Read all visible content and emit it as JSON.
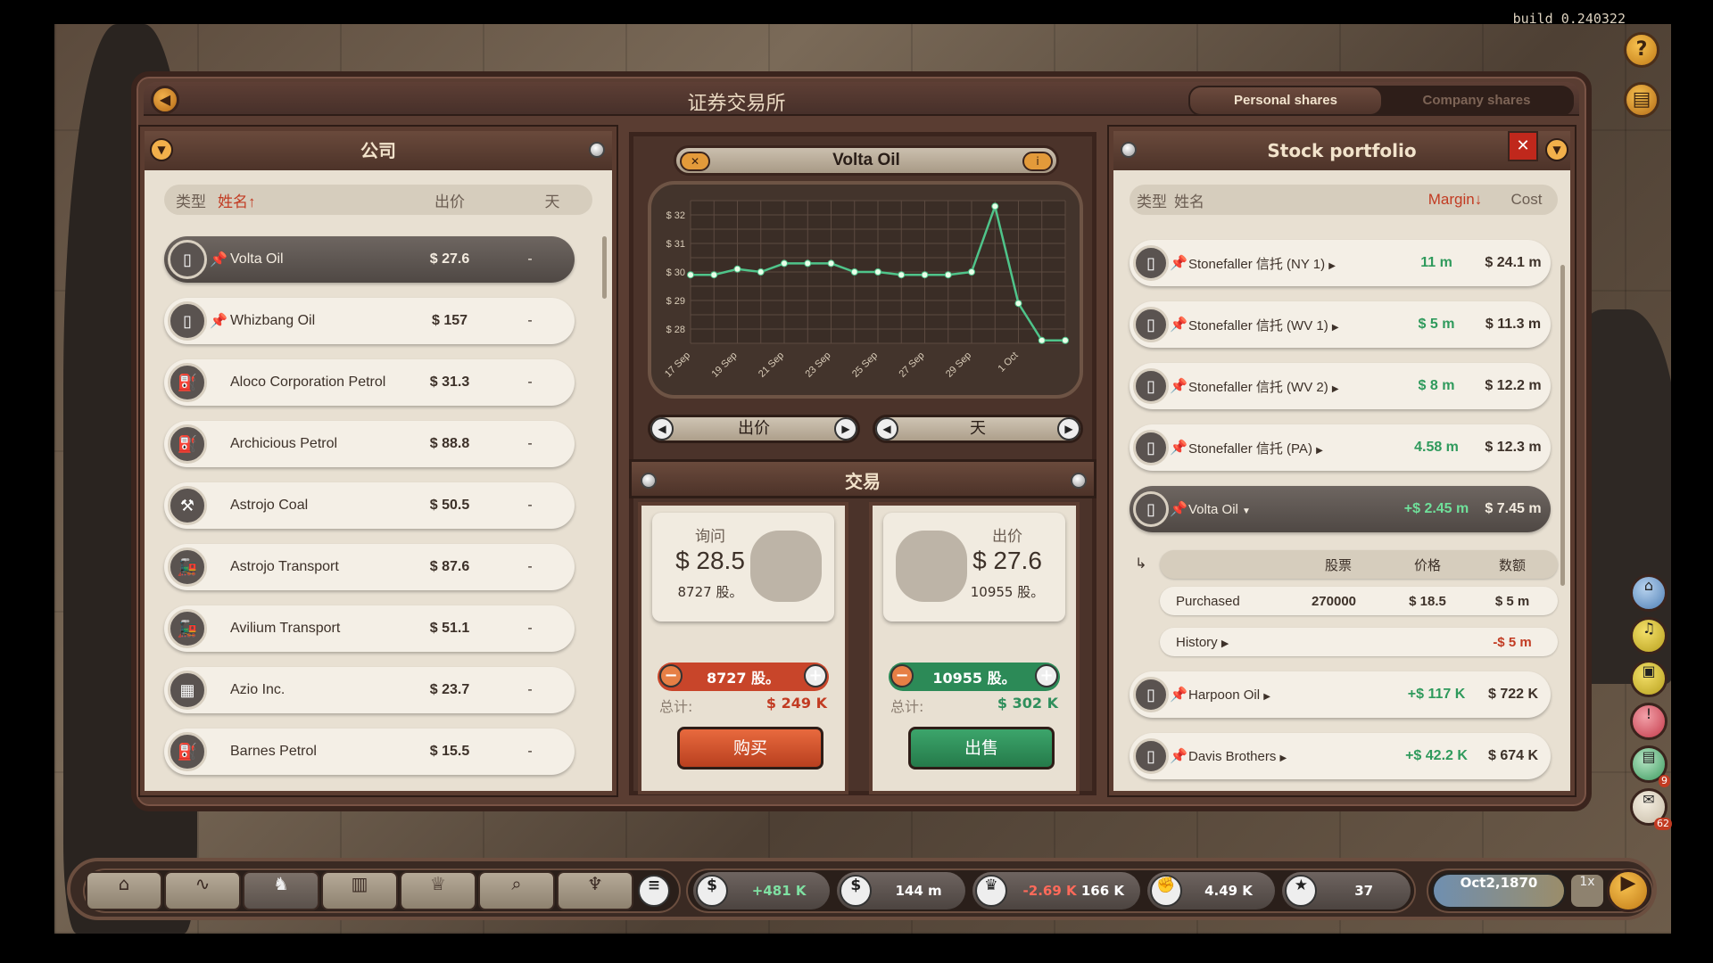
{
  "build": "build 0.240322",
  "window": {
    "title": "证券交易所",
    "tabs": [
      "Personal shares",
      "Company shares"
    ]
  },
  "companies": {
    "title": "公司",
    "headers": {
      "type": "类型",
      "name": "姓名↑",
      "price": "出价",
      "day": "天"
    },
    "rows": [
      {
        "name": "Volta Oil",
        "price": "$ 27.6",
        "day": "-",
        "icon": "oil-rig-icon",
        "pinned": true,
        "selected": true
      },
      {
        "name": "Whizbang Oil",
        "price": "$ 157",
        "day": "-",
        "icon": "oil-rig-icon",
        "pinned": true
      },
      {
        "name": "Aloco Corporation Petrol",
        "price": "$ 31.3",
        "day": "-",
        "icon": "oil-can-icon"
      },
      {
        "name": "Archicious Petrol",
        "price": "$ 88.8",
        "day": "-",
        "icon": "oil-can-icon"
      },
      {
        "name": "Astrojo Coal",
        "price": "$ 50.5",
        "day": "-",
        "icon": "miner-icon"
      },
      {
        "name": "Astrojo Transport",
        "price": "$ 87.6",
        "day": "-",
        "icon": "locomotive-icon"
      },
      {
        "name": "Avilium Transport",
        "price": "$ 51.1",
        "day": "-",
        "icon": "locomotive-icon"
      },
      {
        "name": "Azio Inc.",
        "price": "$ 23.7",
        "day": "-",
        "icon": "building-icon"
      },
      {
        "name": "Barnes Petrol",
        "price": "$ 15.5",
        "day": "-",
        "icon": "oil-can-icon"
      }
    ]
  },
  "chart_panel": {
    "company": "Volta Oil",
    "selector_left": "出价",
    "selector_right": "天"
  },
  "chart_data": {
    "type": "line",
    "title": "",
    "x": [
      "17 Sep",
      "18 Sep",
      "19 Sep",
      "20 Sep",
      "21 Sep",
      "22 Sep",
      "23 Sep",
      "24 Sep",
      "25 Sep",
      "26 Sep",
      "27 Sep",
      "28 Sep",
      "29 Sep",
      "30 Sep",
      "1 Oct",
      "2 Oct",
      "3 Oct"
    ],
    "x_ticks": [
      "17 Sep",
      "19 Sep",
      "21 Sep",
      "23 Sep",
      "25 Sep",
      "27 Sep",
      "29 Sep",
      "1 Oct"
    ],
    "values": [
      29.9,
      29.9,
      30.1,
      30.0,
      30.3,
      30.3,
      30.3,
      30.0,
      30.0,
      29.9,
      29.9,
      29.9,
      30.0,
      32.3,
      28.9,
      27.6,
      27.6
    ],
    "yticks": [
      "$ 32",
      "$ 31",
      "$ 30",
      "$ 29",
      "$ 28"
    ],
    "ylim": [
      27.5,
      32.5
    ],
    "color": "#4fc48a",
    "grid": true
  },
  "trade": {
    "title": "交易",
    "buy": {
      "label": "询问",
      "price": "$ 28.5",
      "shares": "8727 股。",
      "qty": "8727 股。",
      "total_label": "总计:",
      "total": "$ 249 K",
      "button": "购买",
      "color": "#d9512e"
    },
    "sell": {
      "label": "出价",
      "price": "$ 27.6",
      "shares": "10955 股。",
      "qty": "10955 股。",
      "total_label": "总计:",
      "total": "$ 302 K",
      "button": "出售",
      "color": "#2f8f5c"
    }
  },
  "portfolio": {
    "title": "Stock portfolio",
    "headers": {
      "type": "类型",
      "name": "姓名",
      "margin": "Margin↓",
      "cost": "Cost"
    },
    "rows": [
      {
        "name": "Stonefaller 信托 (NY 1)",
        "margin": "11 m",
        "cost": "$ 24.1 m"
      },
      {
        "name": "Stonefaller 信托 (WV 1)",
        "margin": "$ 5 m",
        "cost": "$ 11.3 m"
      },
      {
        "name": "Stonefaller 信托 (WV 2)",
        "margin": "$ 8 m",
        "cost": "$ 12.2 m"
      },
      {
        "name": "Stonefaller 信托 (PA)",
        "margin": "4.58 m",
        "cost": "$ 12.3 m"
      },
      {
        "name": "Volta Oil",
        "margin": "+$ 2.45 m",
        "cost": "$ 7.45 m"
      }
    ],
    "detail": {
      "h1": "股票",
      "h2": "价格",
      "h3": "数额",
      "purchased_label": "Purchased",
      "purchased_qty": "270000",
      "purchased_price": "$ 18.5",
      "purchased_amount": "$ 5 m",
      "history_label": "History",
      "history_amount": "-$ 5 m"
    },
    "rows2": [
      {
        "name": "Harpoon Oil",
        "margin": "+$ 117 K",
        "cost": "$ 722 K"
      },
      {
        "name": "Davis Brothers",
        "margin": "+$ 42.2 K",
        "cost": "$ 674 K"
      }
    ]
  },
  "bottom": {
    "income": "+481 K",
    "money": "144 m",
    "prestige_change": "-2.69 K",
    "prestige": "166 K",
    "influence": "4.49 K",
    "stars": "37",
    "date": "Oct2,1870",
    "speed": "1x"
  },
  "side_badges": {
    "ledger": "9",
    "mail": "62"
  }
}
